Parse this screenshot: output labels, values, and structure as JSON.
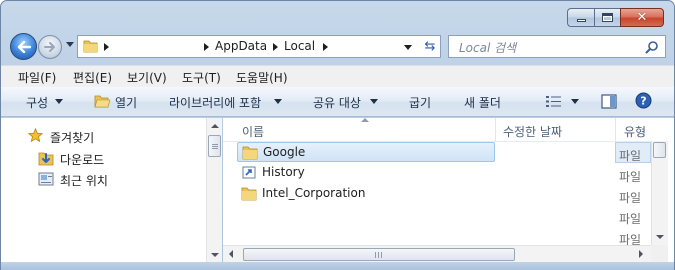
{
  "window": {
    "caption_buttons": {
      "minimize": "minimize",
      "maximize": "maximize",
      "close": "close"
    }
  },
  "navigation": {
    "breadcrumbs": [
      "AppData",
      "Local"
    ],
    "search_placeholder": "Local 검색"
  },
  "menu": [
    "파일(F)",
    "편집(E)",
    "보기(V)",
    "도구(T)",
    "도움말(H)"
  ],
  "commands": {
    "organize": "구성",
    "open": "열기",
    "include_library": "라이브러리에 포함",
    "share_with": "공유 대상",
    "burn": "굽기",
    "new_folder": "새 폴더"
  },
  "nav_pane": {
    "favorites": "즐겨찾기",
    "items": [
      "다운로드",
      "최근 위치"
    ]
  },
  "columns": {
    "name": "이름",
    "date_modified": "수정한 날짜",
    "type": "유형"
  },
  "files": [
    {
      "name": "Google",
      "icon": "folder-icon",
      "type": "파일"
    },
    {
      "name": "History",
      "icon": "shortcut-icon",
      "type": "파일"
    },
    {
      "name": "Intel_Corporation",
      "icon": "folder-icon",
      "type": "파일"
    },
    {
      "name": "",
      "icon": "",
      "type": "파일"
    },
    {
      "name": "",
      "icon": "",
      "type": "파일"
    }
  ],
  "colors": {
    "accent": "#3b82d8",
    "selection": "#cfe3f8"
  }
}
